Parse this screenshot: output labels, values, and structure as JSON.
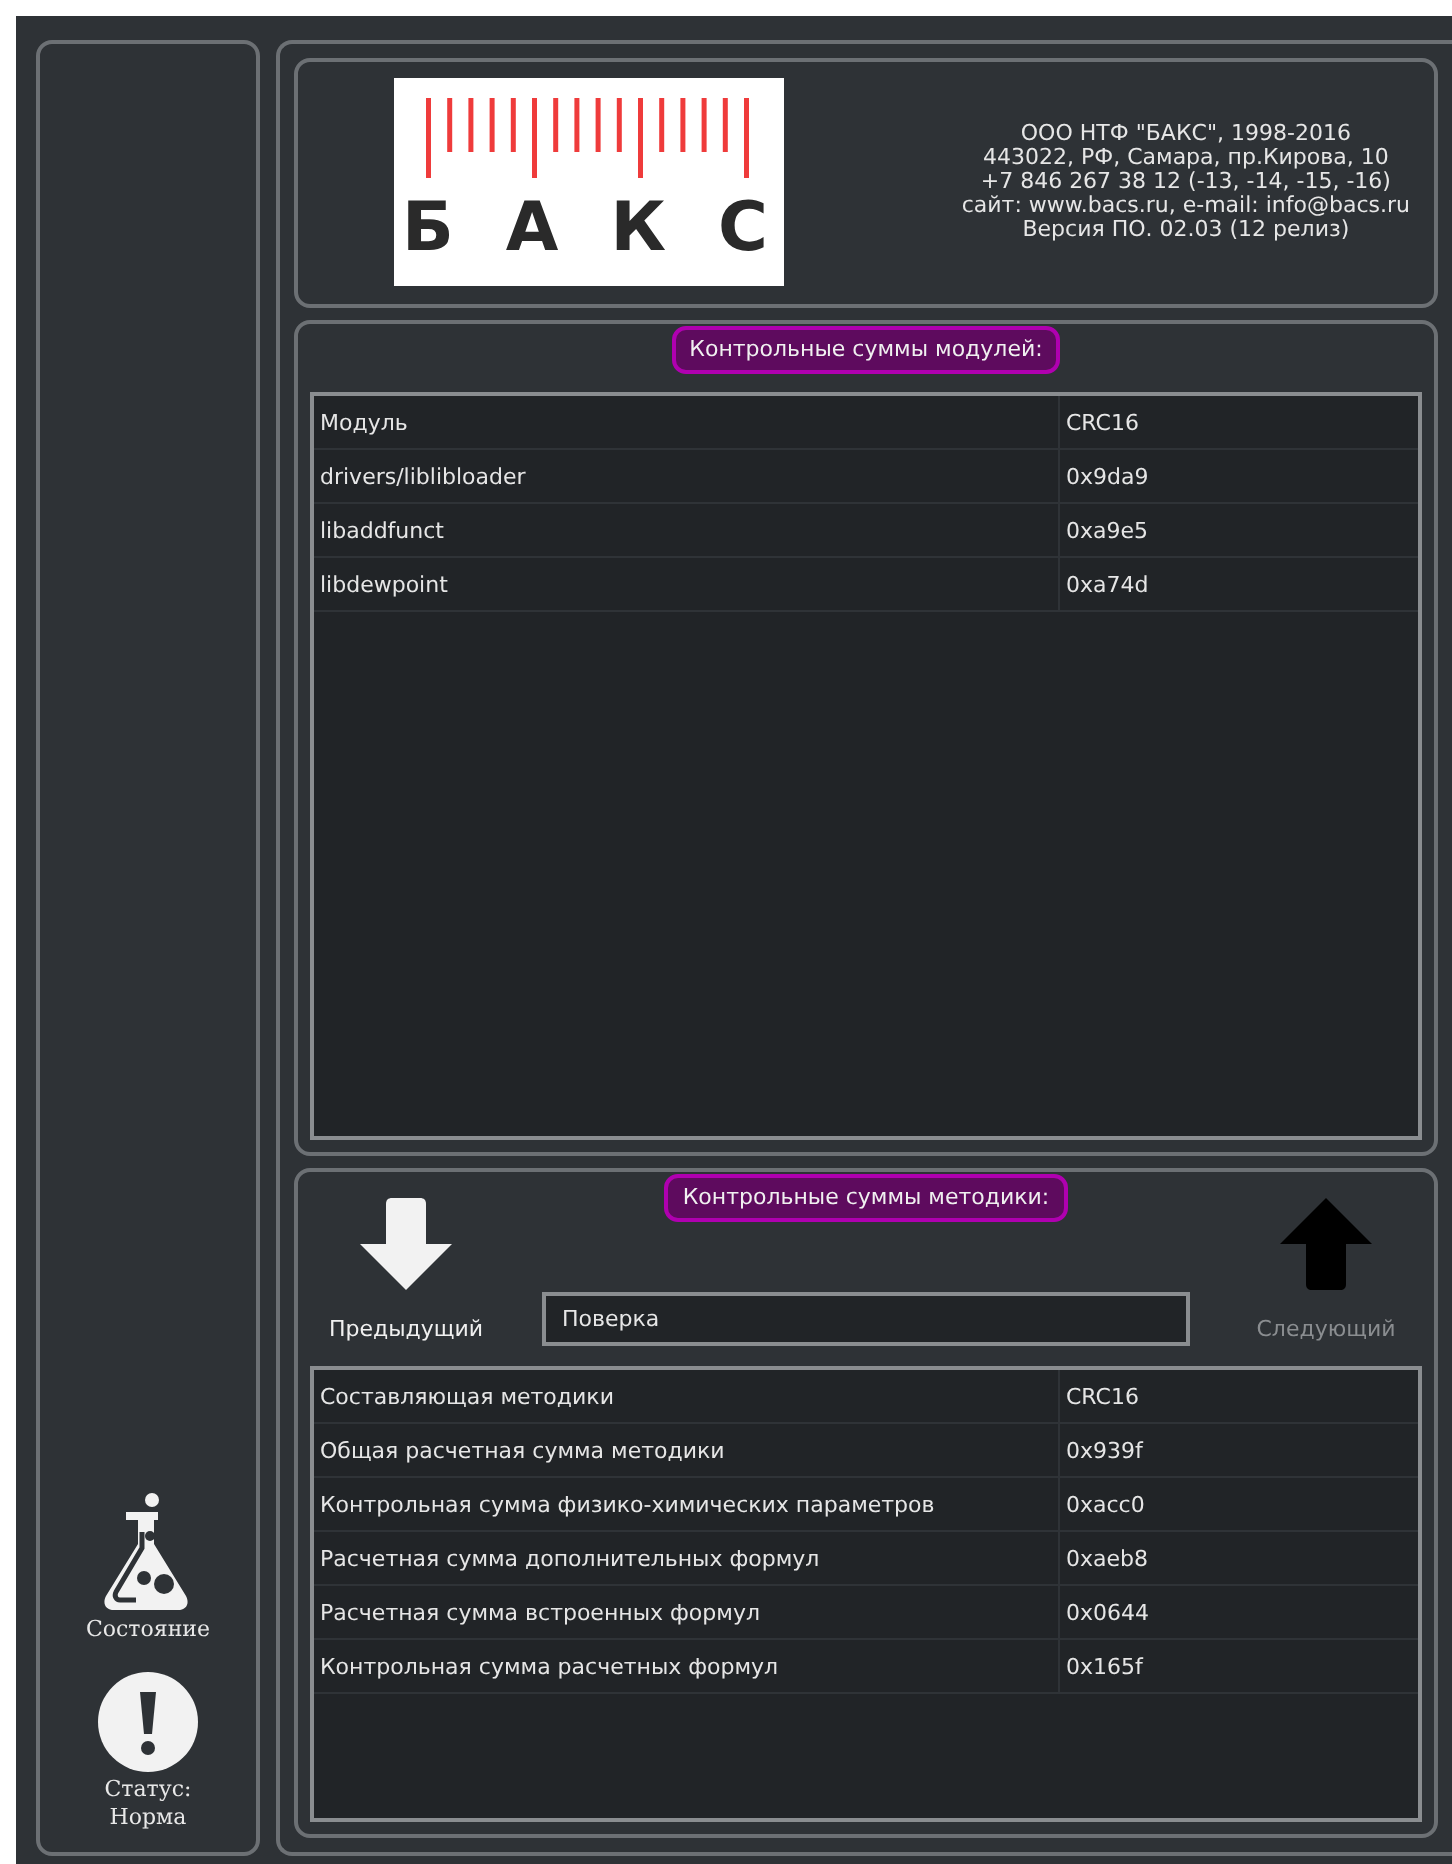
{
  "sidebar": {
    "items": [
      {
        "kind": "flask",
        "label": "Состояние"
      },
      {
        "kind": "alert",
        "label": "Статус:\nНорма"
      }
    ]
  },
  "header": {
    "logo": {
      "text": "БАКС"
    },
    "info": [
      "ООО НТФ \"БАКС\", 1998-2016",
      "443022, РФ, Самара, пр.Кирова, 10",
      "+7 846 267 38 12 (-13, -14, -15, -16)",
      "сайт: www.bacs.ru, e-mail: info@bacs.ru",
      "Версия ПО. 02.03 (12 релиз)"
    ]
  },
  "modules": {
    "title": "Контрольные суммы модулей:",
    "columns": [
      "Модуль",
      "CRC16"
    ],
    "rows": [
      [
        "drivers/liblibloader",
        "0x9da9"
      ],
      [
        "libaddfunct",
        "0xa9e5"
      ],
      [
        "libdewpoint",
        "0xa74d"
      ]
    ]
  },
  "method": {
    "title": "Контрольные суммы методики:",
    "prev": {
      "label": "Предыдущий",
      "disabled": false
    },
    "next": {
      "label": "Следующий",
      "disabled": true
    },
    "field": {
      "value": "Поверка"
    },
    "columns": [
      "Составляющая методики",
      "CRC16"
    ],
    "rows": [
      [
        "Общая расчетная сумма методики",
        "0x939f"
      ],
      [
        "Контрольная сумма физико-химических параметров",
        "0xacc0"
      ],
      [
        "Расчетная сумма дополнительных формул",
        "0xaeb8"
      ],
      [
        "Расчетная сумма встроенных формул",
        "0x0644"
      ],
      [
        "Контрольная сумма расчетных формул",
        "0x165f"
      ]
    ]
  }
}
